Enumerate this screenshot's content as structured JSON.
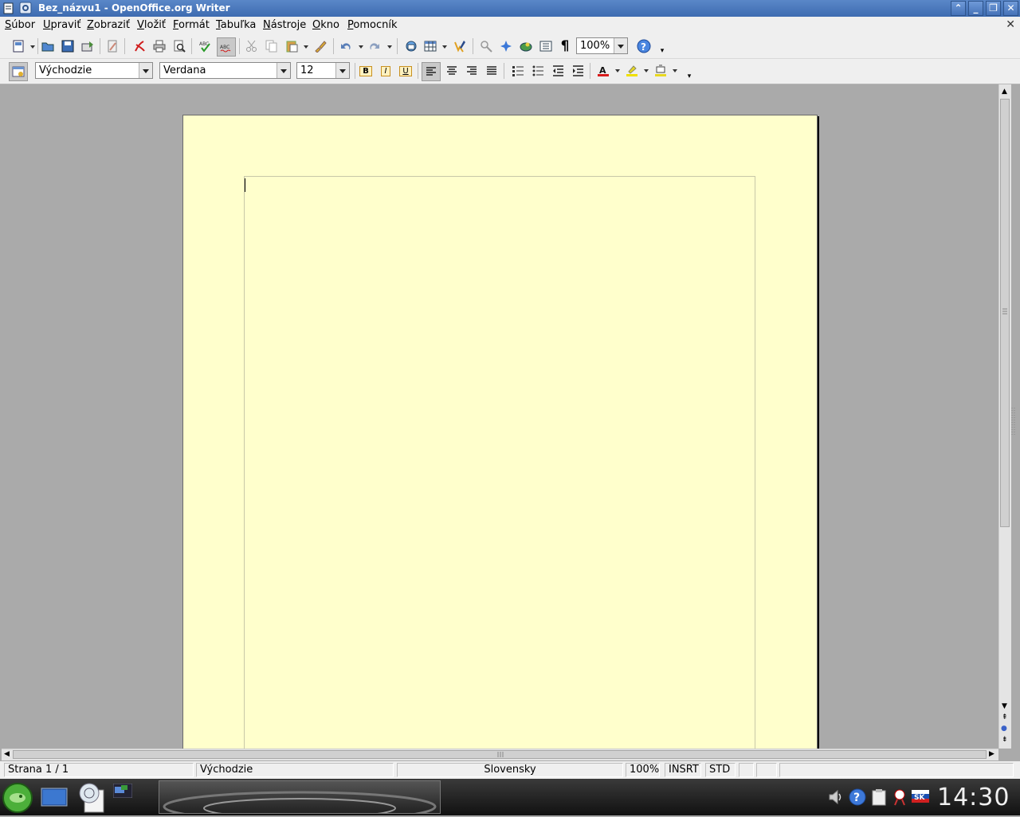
{
  "window": {
    "title": "Bez_názvu1 - OpenOffice.org Writer",
    "buttons": [
      "shade-up-icon",
      "minimize-icon",
      "restore-icon",
      "close-icon"
    ]
  },
  "menu": {
    "items": [
      {
        "label": "Súbor",
        "accel": "S"
      },
      {
        "label": "Upraviť",
        "accel": "U"
      },
      {
        "label": "Zobraziť",
        "accel": "Z"
      },
      {
        "label": "Vložiť",
        "accel": "V"
      },
      {
        "label": "Formát",
        "accel": "F"
      },
      {
        "label": "Tabuľka",
        "accel": "T"
      },
      {
        "label": "Nástroje",
        "accel": "N"
      },
      {
        "label": "Okno",
        "accel": "O"
      },
      {
        "label": "Pomocník",
        "accel": "P"
      }
    ]
  },
  "toolbar": {
    "zoom": "100%"
  },
  "formatting": {
    "style": "Východzie",
    "font": "Verdana",
    "size": "12",
    "bold": "B",
    "italic": "I",
    "underline": "U"
  },
  "status": {
    "page": "Strana 1 / 1",
    "style": "Východzie",
    "language": "Slovensky",
    "zoom": "100%",
    "insert_mode": "INSRT",
    "selection_mode": "STD"
  },
  "taskbar": {
    "clock": "14:30"
  },
  "colors": {
    "page_background": "#ffffcc",
    "title_bar": "#4a78bd"
  }
}
